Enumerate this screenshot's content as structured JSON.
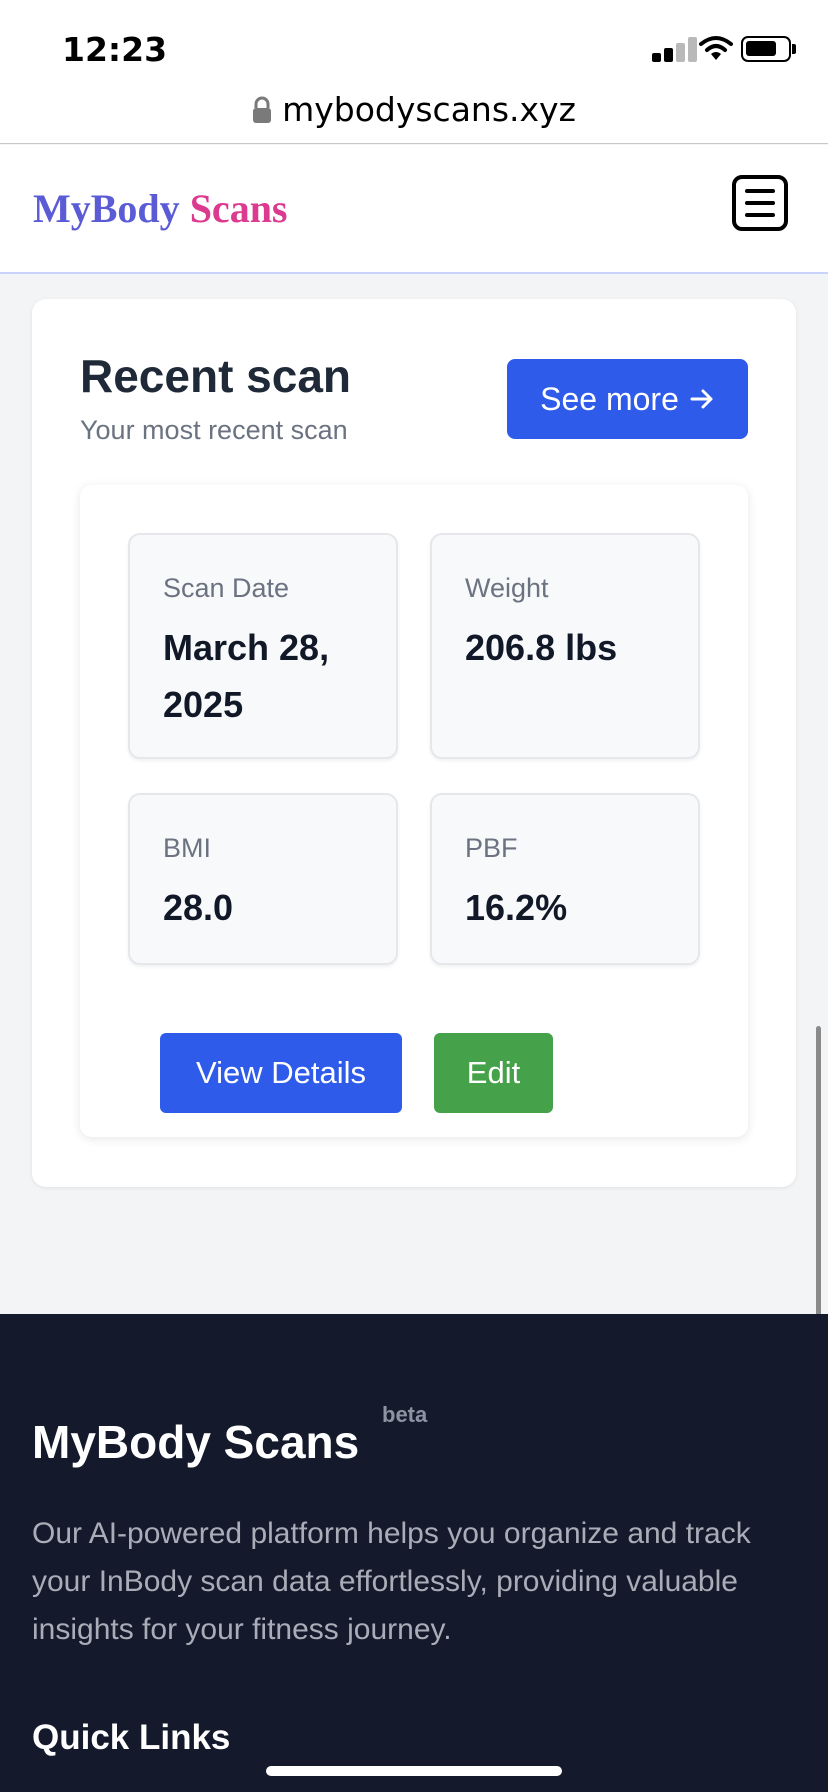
{
  "status_bar": {
    "time": "12:23"
  },
  "browser": {
    "url": "mybodyscans.xyz"
  },
  "header": {
    "logo_part1": "MyBody",
    "logo_part2": "Scans"
  },
  "recent_scan": {
    "title": "Recent scan",
    "subtitle": "Your most recent scan",
    "see_more_label": "See more",
    "stats": [
      {
        "label": "Scan Date",
        "value": "March 28, 2025"
      },
      {
        "label": "Weight",
        "value": "206.8 lbs"
      },
      {
        "label": "BMI",
        "value": "28.0"
      },
      {
        "label": "PBF",
        "value": "16.2%"
      }
    ],
    "view_details_label": "View Details",
    "edit_label": "Edit"
  },
  "footer": {
    "title": "MyBody Scans",
    "badge": "beta",
    "description": "Our AI-powered platform helps you organize and track your InBody scan data effortlessly, providing valuable insights for your fitness journey.",
    "quick_links_heading": "Quick Links"
  },
  "colors": {
    "primary_button": "#2f5bea",
    "edit_button": "#46a24a",
    "logo_primary": "#5b5bd6",
    "logo_accent": "#db3a8e",
    "footer_bg": "#141a2b"
  }
}
